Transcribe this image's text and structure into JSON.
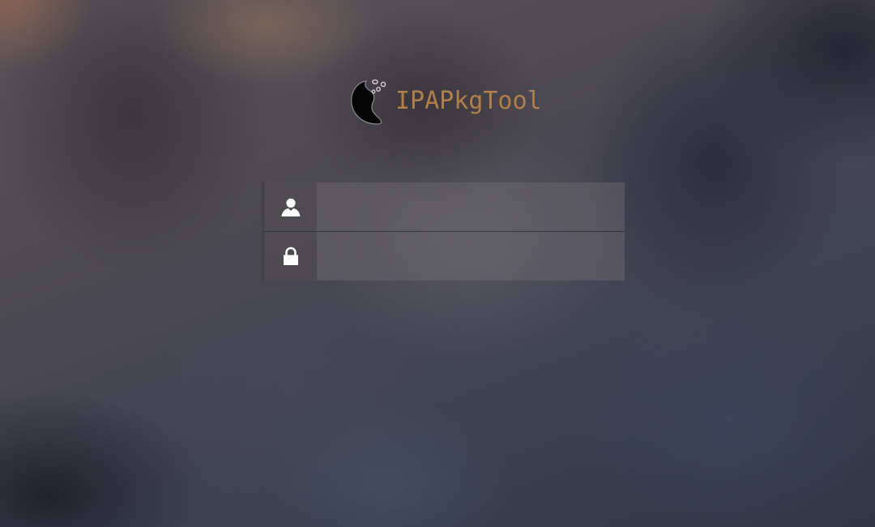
{
  "app": {
    "title": "IPAPkgTool",
    "brand_color": "#b27e4a",
    "logo_icon": "paisley-logo-icon"
  },
  "login": {
    "username": {
      "icon": "user-icon",
      "value": "",
      "placeholder": ""
    },
    "password": {
      "icon": "lock-icon",
      "value": "",
      "placeholder": ""
    }
  }
}
